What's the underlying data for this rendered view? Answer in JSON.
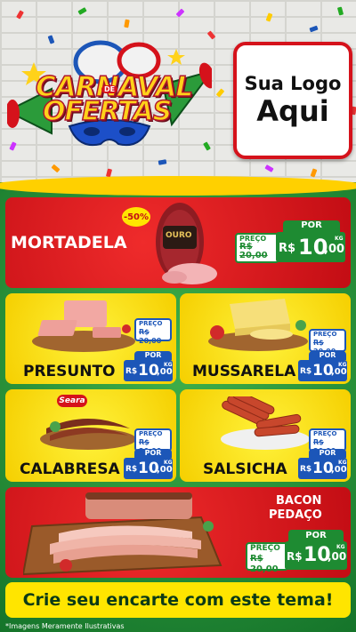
{
  "header": {
    "title_line1": "CARNAVAL",
    "title_de": "DE",
    "title_line2": "OFERTAS",
    "logo_line1": "Sua Logo",
    "logo_line2": "Aqui"
  },
  "featured": {
    "name": "MORTADELA",
    "discount_badge": "-50%",
    "brand_label": "OURO",
    "preco_label": "PREÇO",
    "old_price": "R$ 20,00",
    "por_label": "POR",
    "currency": "R$",
    "price_int": "10",
    "price_cents": ",00",
    "unit": "KG"
  },
  "products": [
    {
      "name": "PRESUNTO",
      "preco_label": "PREÇO",
      "old_price": "R$ 20,00",
      "por_label": "POR",
      "currency": "R$",
      "price_int": "10",
      "price_cents": ",00",
      "unit": "KG"
    },
    {
      "name": "MUSSARELA",
      "preco_label": "PREÇO",
      "old_price": "R$ 20,00",
      "por_label": "POR",
      "currency": "R$",
      "price_int": "10",
      "price_cents": ",00",
      "unit": "KG"
    },
    {
      "name": "CALABRESA",
      "brand_label": "Seara",
      "preco_label": "PREÇO",
      "old_price": "R$ 20,00",
      "por_label": "POR",
      "currency": "R$",
      "price_int": "10",
      "price_cents": ",00",
      "unit": "KG"
    },
    {
      "name": "SALSICHA",
      "preco_label": "PREÇO",
      "old_price": "R$ 20,00",
      "por_label": "POR",
      "currency": "R$",
      "price_int": "10",
      "price_cents": ",00",
      "unit": "KG"
    }
  ],
  "bacon": {
    "name_line1": "BACON",
    "name_line2": "PEDAÇO",
    "preco_label": "PREÇO",
    "old_price": "R$ 20,00",
    "por_label": "POR",
    "currency": "R$",
    "price_int": "10",
    "price_cents": ",00",
    "unit": "KG"
  },
  "cta": "Crie seu encarte com este tema!",
  "disclaimer": "*Imagens Meramente Ilustrativas",
  "colors": {
    "red": "#d5121b",
    "yellow": "#ffd400",
    "green": "#1e8b32",
    "blue": "#1c56b8"
  }
}
